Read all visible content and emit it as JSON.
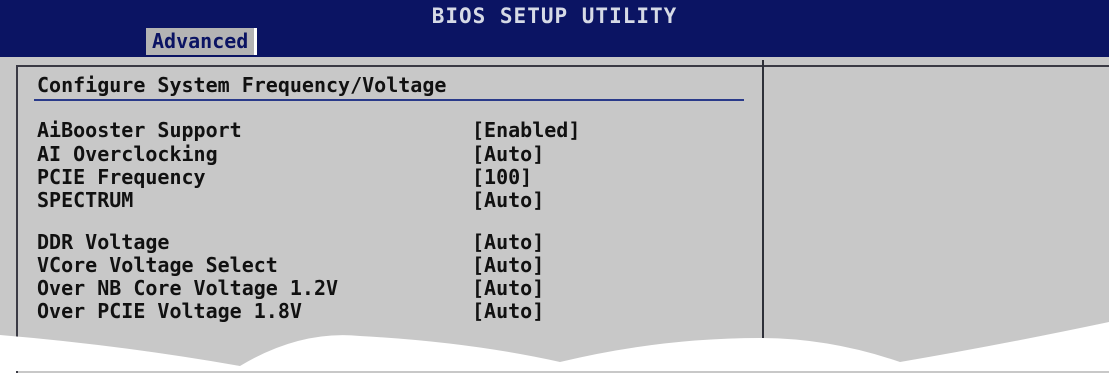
{
  "header": {
    "title": "BIOS SETUP UTILITY",
    "active_tab": "Advanced"
  },
  "section": {
    "title": "Configure System Frequency/Voltage"
  },
  "settings_group1": [
    {
      "label": "AiBooster Support",
      "value": "[Enabled]"
    },
    {
      "label": "AI Overclocking",
      "value": "[Auto]"
    },
    {
      "label": "PCIE Frequency",
      "value": "[100]"
    },
    {
      "label": "SPECTRUM",
      "value": "[Auto]"
    }
  ],
  "settings_group2": [
    {
      "label": "DDR Voltage",
      "value": "[Auto]"
    },
    {
      "label": "VCore Voltage Select",
      "value": "[Auto]"
    },
    {
      "label": "Over NB Core Voltage 1.2V",
      "value": "[Auto]"
    },
    {
      "label": "Over PCIE Voltage 1.8V",
      "value": "[Auto]"
    }
  ]
}
